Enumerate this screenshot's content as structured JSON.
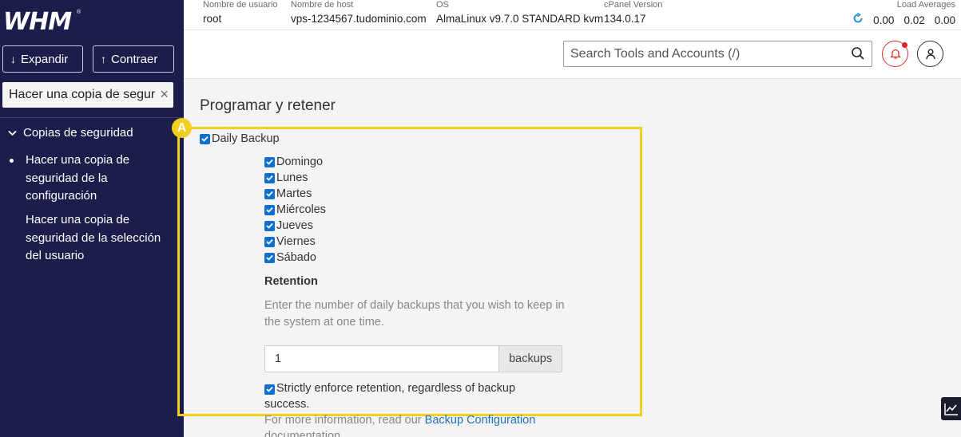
{
  "app": {
    "logo_text": "WHM",
    "logo_mark": "®"
  },
  "sidebar": {
    "expand_label": "Expandir",
    "collapse_label": "Contraer",
    "search_value": "Hacer una copia de seguridad",
    "section_label": "Copias de seguridad",
    "items": [
      {
        "label": "Hacer una copia de seguridad de la configuración",
        "active": true
      },
      {
        "label": "Hacer una copia de seguridad de la selección del usuario",
        "active": false
      }
    ]
  },
  "topbar": {
    "username_label": "Nombre de usuario",
    "username": "root",
    "hostname_label": "Nombre de host",
    "hostname": "vps-1234567.tudominio.com",
    "os_label": "OS",
    "os": "AlmaLinux v9.7.0 STANDARD kvm",
    "cpanel_label": "cPanel Version",
    "cpanel_version": "134.0.17",
    "load_label": "Load Averages",
    "load_values": [
      "0.00",
      "0.02",
      "0.00"
    ]
  },
  "header": {
    "search_placeholder": "Search Tools and Accounts (/)"
  },
  "main": {
    "section_title": "Programar y retener",
    "annotation_badge": "A",
    "daily_backup_label": "Daily Backup",
    "daily_backup_checked": true,
    "days": [
      {
        "label": "Domingo",
        "checked": true
      },
      {
        "label": "Lunes",
        "checked": true
      },
      {
        "label": "Martes",
        "checked": true
      },
      {
        "label": "Miércoles",
        "checked": true
      },
      {
        "label": "Jueves",
        "checked": true
      },
      {
        "label": "Viernes",
        "checked": true
      },
      {
        "label": "Sábado",
        "checked": true
      }
    ],
    "retention_title": "Retention",
    "retention_help": "Enter the number of daily backups that you wish to keep in the system at one time.",
    "retention_value": "1",
    "retention_unit": "backups",
    "strict_label": "Strictly enforce retention, regardless of backup success.",
    "strict_checked": true,
    "more_info_prefix": "For more information, read our ",
    "more_info_link": "Backup Configuration",
    "more_info_suffix": " documentation."
  },
  "colors": {
    "sidebar_bg": "#1b1d4a",
    "checkbox": "#0f6fd0",
    "annotation": "#f0cf1e",
    "link": "#1e73be",
    "bell": "#e0202a"
  }
}
